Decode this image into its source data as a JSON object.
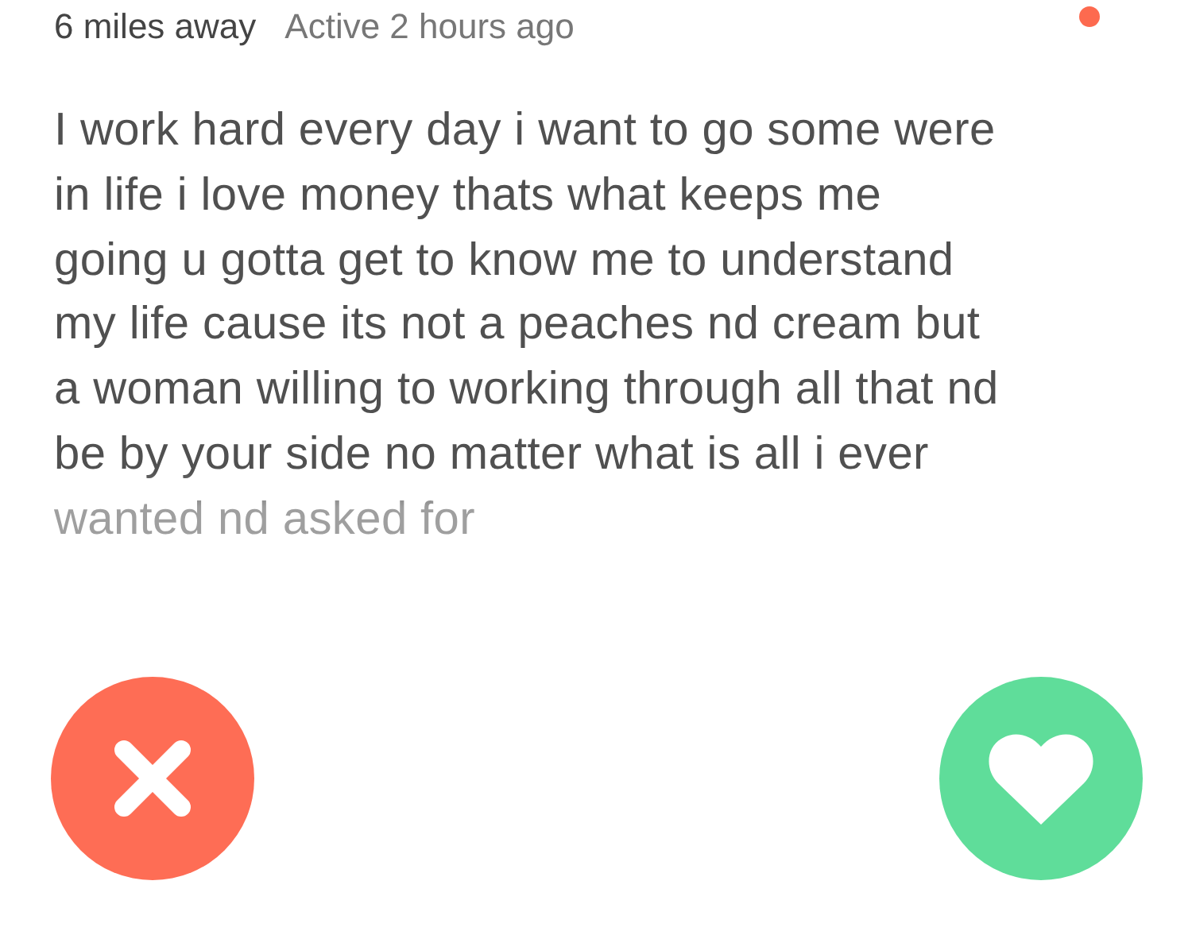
{
  "distance": "6 miles away",
  "active": "Active 2 hours ago",
  "online": true,
  "bio": "I work hard every day i want to go some were\nin life i love money thats what keeps me\ngoing u gotta get to know me to understand\nmy life cause its not a peaches nd cream but\na woman willing to working through all that nd\nbe by your side no matter what is all i ever\nwanted nd asked for",
  "buttons": [
    {
      "kind": "nope"
    },
    {
      "kind": "like"
    }
  ]
}
